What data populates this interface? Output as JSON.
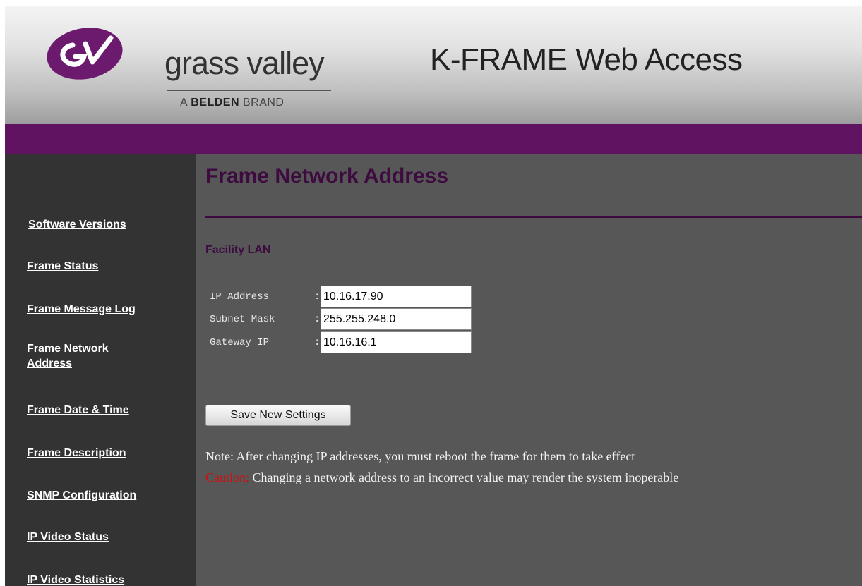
{
  "header": {
    "brand_name": "grass valley",
    "brand_tag_prefix": "A ",
    "brand_tag_bold": "BELDEN",
    "brand_tag_suffix": " BRAND",
    "app_title": "K-FRAME Web Access",
    "logo_icon": "grass-valley-logo"
  },
  "colors": {
    "accent_purple": "#5f1361",
    "title_purple": "#3e0b40",
    "sidebar_bg": "#333333",
    "main_bg": "#575757",
    "caution_red": "#d01010"
  },
  "sidebar": {
    "items": [
      {
        "label": "Software Versions"
      },
      {
        "label": "Frame Status"
      },
      {
        "label": "Frame Message Log"
      },
      {
        "label": "Frame Network Address"
      },
      {
        "label": "Frame Date & Time"
      },
      {
        "label": "Frame Description"
      },
      {
        "label": "SNMP Configuration"
      },
      {
        "label": "IP Video Status"
      },
      {
        "label": "IP Video Statistics"
      }
    ]
  },
  "main": {
    "page_title": "Frame Network Address",
    "section_title": "Facility LAN",
    "fields": [
      {
        "label": "IP Address",
        "colon": ":",
        "value": "10.16.17.90"
      },
      {
        "label": "Subnet Mask",
        "colon": ":",
        "value": "255.255.248.0"
      },
      {
        "label": "Gateway IP",
        "colon": ":",
        "value": "10.16.16.1"
      }
    ],
    "save_label": "Save New Settings",
    "note_text": "Note: After changing IP addresses, you must reboot the frame for them to take effect",
    "caution_word": "Caution:",
    "caution_text": " Changing a network address to an incorrect value may render the system inoperable"
  }
}
